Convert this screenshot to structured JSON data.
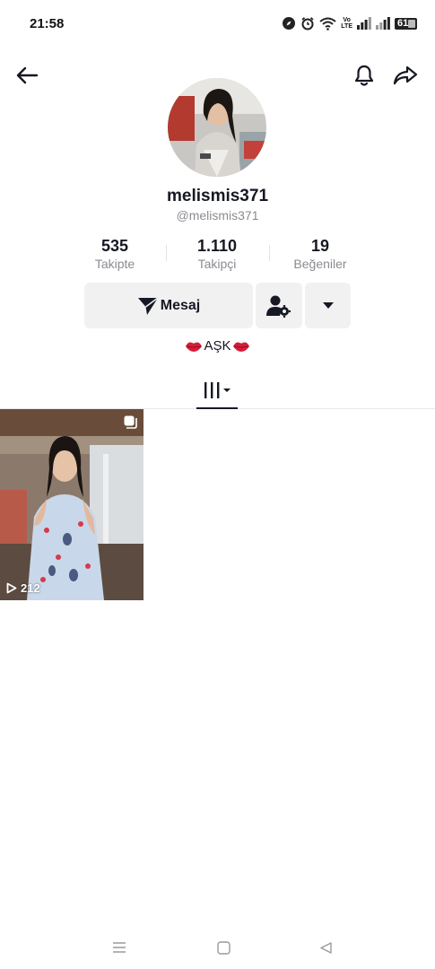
{
  "status_bar": {
    "time": "21:58",
    "volte_top": "Vo",
    "volte_bottom": "LTE",
    "battery_level": "61",
    "icons": [
      "compass-icon",
      "alarm-icon",
      "wifi-icon",
      "volte-icon",
      "signal-icon",
      "signal-icon",
      "battery-icon"
    ]
  },
  "nav": {
    "back_icon": "arrow-left-icon",
    "bell_icon": "bell-icon",
    "share_icon": "share-arrow-icon"
  },
  "profile": {
    "username": "melismis371",
    "handle": "@melismis371",
    "bio": "AŞK"
  },
  "stats": [
    {
      "count": "535",
      "label": "Takipte"
    },
    {
      "count": "1.110",
      "label": "Takipçi"
    },
    {
      "count": "19",
      "label": "Beğeniler"
    }
  ],
  "actions": {
    "message_label": "Mesaj",
    "message_icon": "send-plane-icon",
    "follow_settings_icon": "user-gear-icon",
    "dropdown_icon": "caret-down-icon"
  },
  "tabs": {
    "videos_icon": "grid-bars-icon"
  },
  "videos": [
    {
      "views": "212",
      "badge_icon": "pinned-square-icon"
    }
  ],
  "system_nav": {
    "icons": [
      "menu-icon",
      "home-square-icon",
      "back-triangle-icon"
    ]
  },
  "colors": {
    "text_primary": "#161823",
    "text_secondary": "#8a8b91",
    "button_bg": "#f1f1f2",
    "lips_red": "#d81b3a"
  }
}
